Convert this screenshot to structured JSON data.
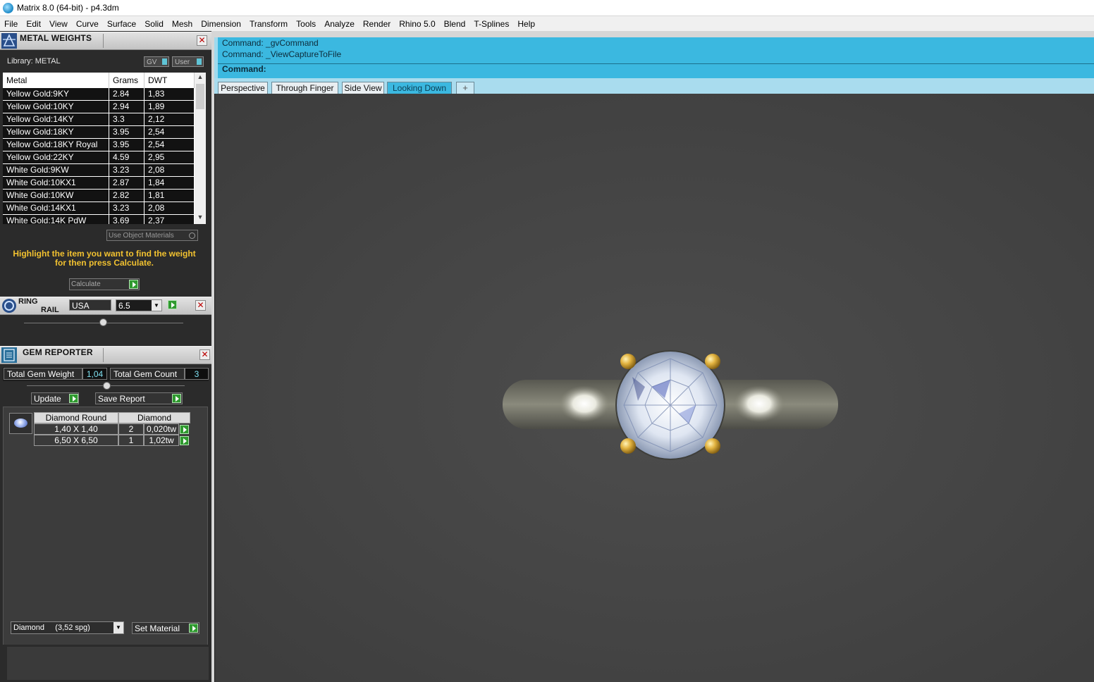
{
  "window": {
    "title": "Matrix 8.0 (64-bit) - p4.3dm"
  },
  "menu": [
    "File",
    "Edit",
    "View",
    "Curve",
    "Surface",
    "Solid",
    "Mesh",
    "Dimension",
    "Transform",
    "Tools",
    "Analyze",
    "Render",
    "Rhino 5.0",
    "Blend",
    "T-Splines",
    "Help"
  ],
  "metal_weights": {
    "title": "METAL WEIGHTS",
    "library_label": "Library: METAL",
    "gv_label": "GV",
    "user_label": "User",
    "columns": [
      "Metal",
      "Grams",
      "DWT"
    ],
    "rows": [
      [
        "Yellow Gold:9KY",
        "2.84",
        "1,83"
      ],
      [
        "Yellow Gold:10KY",
        "2.94",
        "1,89"
      ],
      [
        "Yellow Gold:14KY",
        "3.3",
        "2,12"
      ],
      [
        "Yellow Gold:18KY",
        "3.95",
        "2,54"
      ],
      [
        "Yellow Gold:18KY Royal",
        "3.95",
        "2,54"
      ],
      [
        "Yellow Gold:22KY",
        "4.59",
        "2,95"
      ],
      [
        "White Gold:9KW",
        "3.23",
        "2,08"
      ],
      [
        "White Gold:10KX1",
        "2.87",
        "1,84"
      ],
      [
        "White Gold:10KW",
        "2.82",
        "1,81"
      ],
      [
        "White Gold:14KX1",
        "3.23",
        "2,08"
      ],
      [
        "White Gold:14K PdW",
        "3.69",
        "2,37"
      ]
    ],
    "use_object_materials": "Use Object Materials",
    "hint_line1": "Highlight the item you want to find the weight",
    "hint_line2": "for then press Calculate.",
    "calculate_label": "Calculate"
  },
  "ring_rail": {
    "title_line1": "RING",
    "title_line2": "RAIL",
    "standard": "USA",
    "size": "6.5"
  },
  "gem_reporter": {
    "title": "GEM REPORTER",
    "total_weight_label": "Total Gem Weight",
    "total_weight_value": "1,04",
    "total_count_label": "Total Gem Count",
    "total_count_value": "3",
    "update_label": "Update",
    "save_report_label": "Save Report",
    "table_head": [
      "Diamond Round",
      "Diamond"
    ],
    "rows": [
      [
        "1,40 X 1,40",
        "2",
        "0,020tw"
      ],
      [
        "6,50 X 6,50",
        "1",
        "1,02tw"
      ]
    ],
    "material_select": "Diamond     (3,52 spg)",
    "set_material_label": "Set Material"
  },
  "command": {
    "history": [
      "Command: _gvCommand",
      "Command: _ViewCaptureToFile"
    ],
    "prompt": "Command:"
  },
  "viewport_tabs": [
    "Perspective",
    "Through Finger",
    "Side View",
    "Looking Down"
  ],
  "active_tab": "Looking Down",
  "add_tab_symbol": "+",
  "colors": {
    "command_bg": "#3bb8e0",
    "hint_text": "#f2c230",
    "go_button": "#2f9a2f",
    "viewport_bg": "#444444"
  }
}
